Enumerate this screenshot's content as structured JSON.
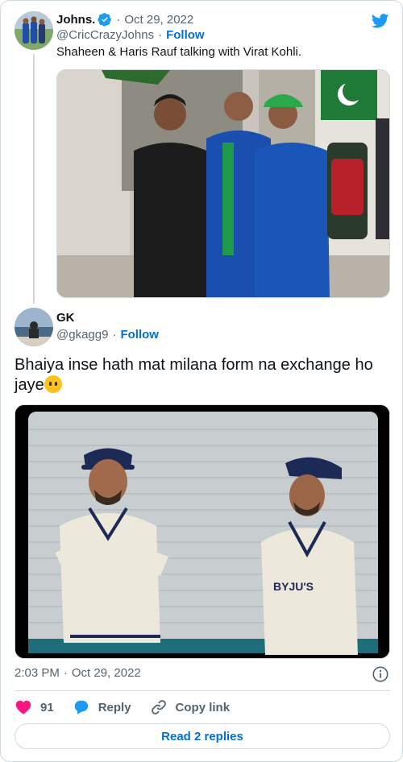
{
  "quoted_tweet": {
    "author_name": "Johns.",
    "verified": true,
    "date": "Oct 29, 2022",
    "handle": "@CricCrazyJohns",
    "follow_label": "Follow",
    "text": "Shaheen & Haris Rauf talking with Virat Kohli."
  },
  "main_tweet": {
    "author_name": "GK",
    "handle": "@gkagg9",
    "follow_label": "Follow",
    "text": "Bhaiya inse hath mat milana form na exchange ho jaye",
    "media_sponsor_text": "BYJU'S",
    "timestamp": "2:03 PM",
    "date": "Oct 29, 2022"
  },
  "actions": {
    "like_count": "91",
    "reply_label": "Reply",
    "copy_link_label": "Copy link"
  },
  "read_replies_label": "Read 2 replies",
  "colors": {
    "link_blue": "#006fd6",
    "twitter_blue": "#1d9bf0",
    "like_red": "#f91880",
    "muted": "#536471",
    "border": "#cfd9de"
  }
}
